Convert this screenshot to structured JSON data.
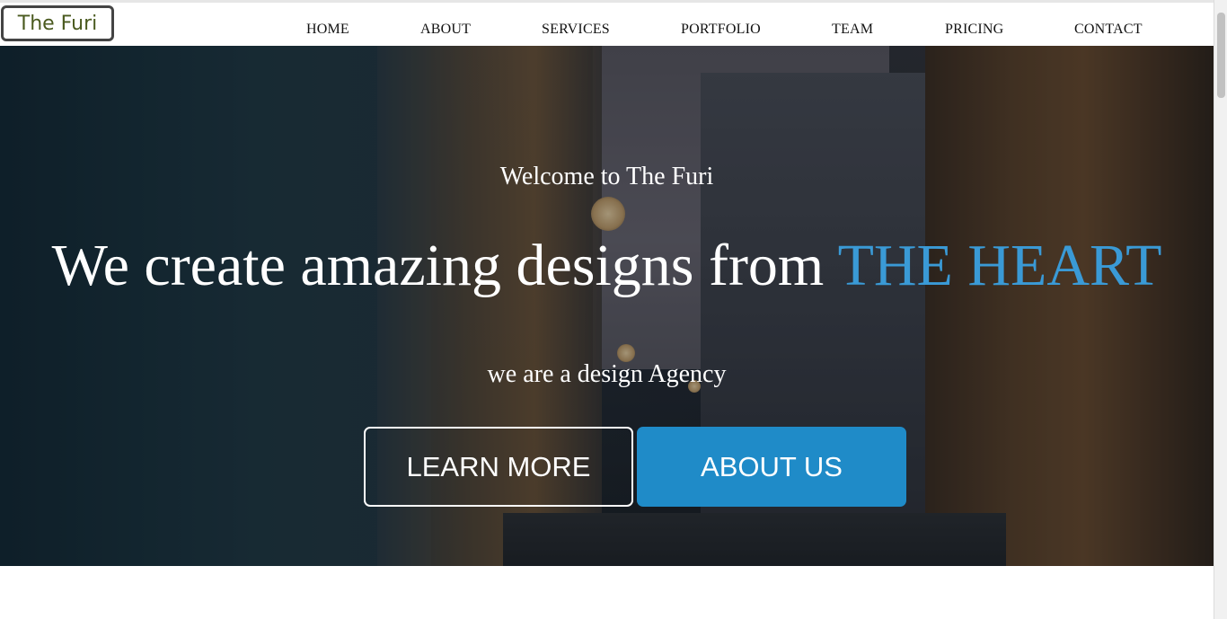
{
  "brand": {
    "logo_text": "The Furi"
  },
  "nav": {
    "items": [
      {
        "label": "HOME"
      },
      {
        "label": "ABOUT"
      },
      {
        "label": "SERVICES"
      },
      {
        "label": "PORTFOLIO"
      },
      {
        "label": "TEAM"
      },
      {
        "label": "PRICING"
      },
      {
        "label": "CONTACT"
      }
    ]
  },
  "hero": {
    "welcome": "Welcome to The Furi",
    "headline_main": "We create amazing designs from",
    "headline_accent": "THE HEART",
    "tagline": "we are a design Agency",
    "learn_more_label": "LEARN MORE",
    "about_us_label": "ABOUT US"
  },
  "colors": {
    "accent": "#3a9ad6",
    "button_primary": "#1f8bc8",
    "logo_text": "#4a5a1f"
  }
}
